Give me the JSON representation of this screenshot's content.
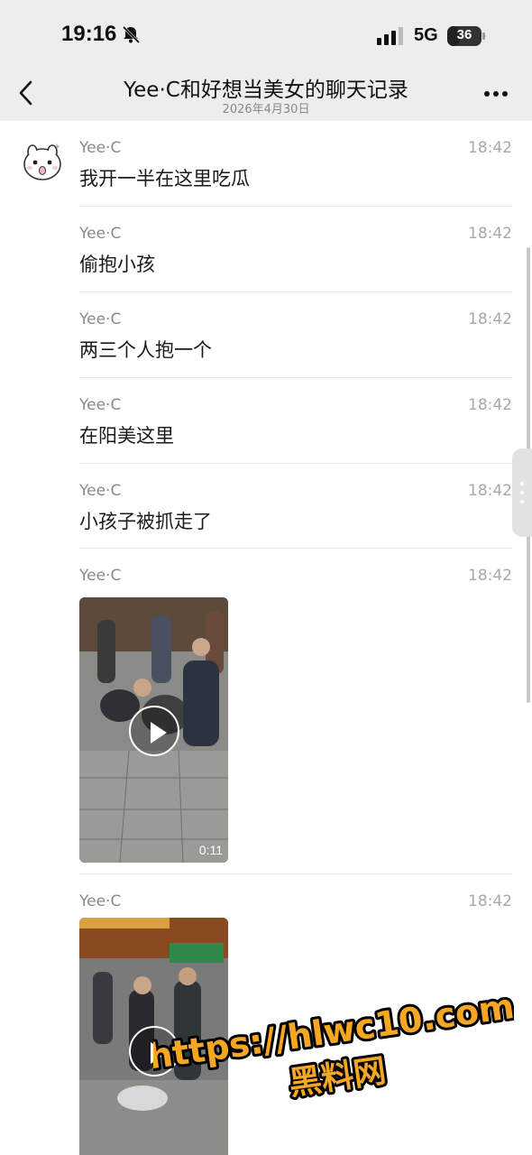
{
  "status_bar": {
    "time": "19:16",
    "network": "5G",
    "battery_percent": "36",
    "battery_level": 0.36,
    "icons": [
      "bell-muted-icon",
      "signal-icon",
      "battery-icon"
    ]
  },
  "nav": {
    "title": "Yee·C和好想当美女的聊天记录",
    "date": "2026年4月30日",
    "icons": [
      "back-icon",
      "more-icon"
    ]
  },
  "messages": [
    {
      "sender": "Yee·C",
      "time": "18:42",
      "text": "我开一半在这里吃瓜"
    },
    {
      "sender": "Yee·C",
      "time": "18:42",
      "text": "偷抱小孩"
    },
    {
      "sender": "Yee·C",
      "time": "18:42",
      "text": "两三个人抱一个"
    },
    {
      "sender": "Yee·C",
      "time": "18:42",
      "text": "在阳美这里"
    },
    {
      "sender": "Yee·C",
      "time": "18:42",
      "text": "小孩子被抓走了"
    },
    {
      "sender": "Yee·C",
      "time": "18:42",
      "video_duration": "0:11"
    },
    {
      "sender": "Yee·C",
      "time": "18:42",
      "video_duration": ""
    }
  ],
  "watermark": {
    "url": "https://hlwc10.com",
    "name": "黑料网",
    "color": "#f5a623"
  }
}
